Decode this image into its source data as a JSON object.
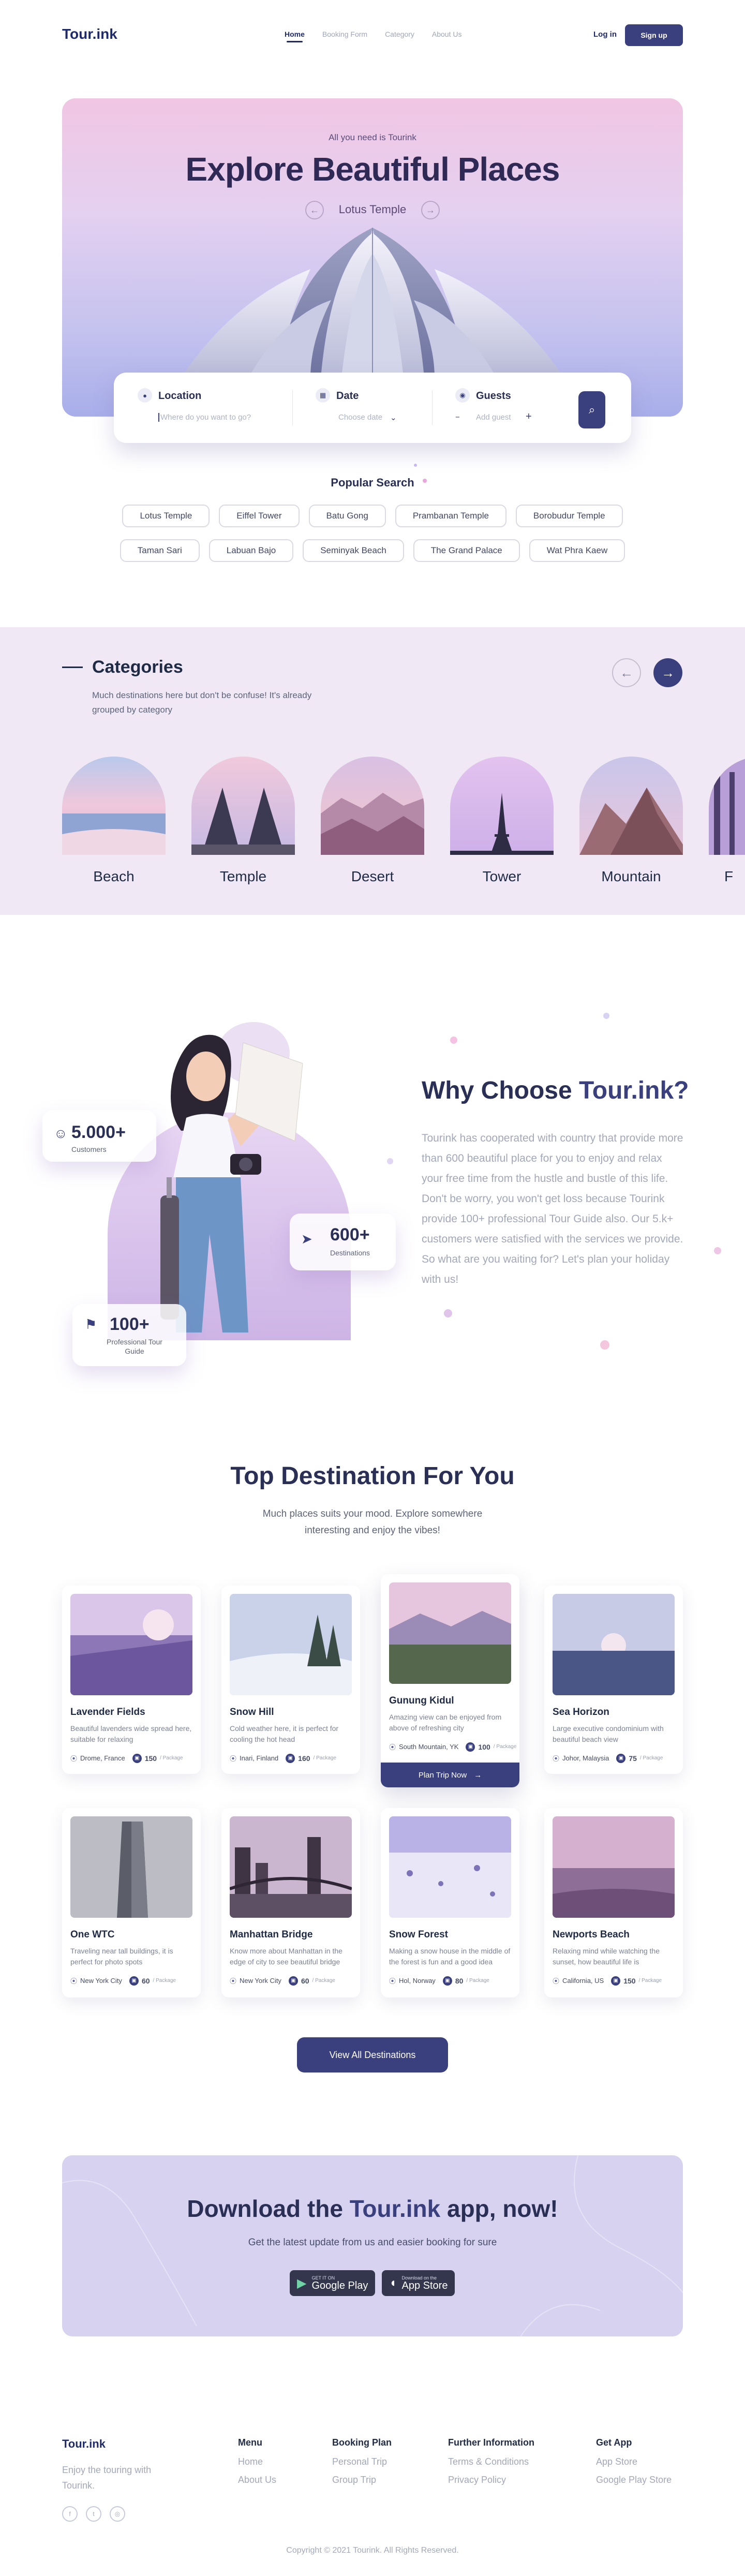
{
  "nav": {
    "logo": "Tour.ink",
    "links": [
      "Home",
      "Booking Form",
      "Category",
      "About Us"
    ],
    "login": "Log in",
    "signup": "Sign up"
  },
  "hero": {
    "tagline": "All you need is Tourink",
    "title": "Explore Beautiful Places",
    "place": "Lotus Temple",
    "prev_icon": "arrow-left-icon",
    "next_icon": "arrow-right-icon"
  },
  "search": {
    "location_label": "Location",
    "location_placeholder": "Where do you want to go?",
    "date_label": "Date",
    "date_value": "Choose date",
    "guests_label": "Guests",
    "guests_value": "Add guest",
    "decrease": "−",
    "increase": "+"
  },
  "popular": {
    "title": "Popular Search",
    "row1": [
      "Lotus Temple",
      "Eiffel Tower",
      "Batu Gong",
      "Prambanan Temple",
      "Borobudur Temple"
    ],
    "row2": [
      "Taman Sari",
      "Labuan Bajo",
      "Seminyak Beach",
      "The Grand Palace",
      "Wat Phra Kaew"
    ]
  },
  "categories": {
    "title": "Categories",
    "description": "Much destinations here but don't be confuse! It's already grouped by category",
    "items": [
      "Beach",
      "Temple",
      "Desert",
      "Tower",
      "Mountain",
      "F"
    ]
  },
  "why": {
    "title_a": "Why Choose ",
    "title_b": "Tour.ink?",
    "body": "Tourink has cooperated with country that provide more than 600 beautiful place for you to enjoy and relax your free time from the hustle and bustle of this life. Don't be worry, you won't get loss because Tourink provide 100+ professional Tour Guide also. Our 5.k+ customers were satisfied with the services we provide. So what are you waiting for? Let's plan your holiday with us!",
    "stats": [
      {
        "num": "5.000+",
        "cap": "Customers"
      },
      {
        "num": "600+",
        "cap": "Destinations"
      },
      {
        "num": "100+",
        "cap": "Professional Tour Guide"
      }
    ]
  },
  "top": {
    "title": "Top Destination For You",
    "subtitle": "Much places suits your mood. Explore somewhere interesting and enjoy the vibes!",
    "package_suffix": "/ Package",
    "plan_label": "Plan Trip Now",
    "cards": [
      {
        "name": "Lavender Fields",
        "desc": "Beautiful lavenders wide spread here, suitable for relaxing",
        "loc": "Drome, France",
        "count": "150"
      },
      {
        "name": "Snow Hill",
        "desc": "Cold weather here, it is perfect for cooling the hot head",
        "loc": "Inari, Finland",
        "count": "160"
      },
      {
        "name": "Gunung Kidul",
        "desc": "Amazing view can be enjoyed from above of refreshing city",
        "loc": "South Mountain, YK",
        "count": "100"
      },
      {
        "name": "Sea Horizon",
        "desc": "Large executive condominium with beautiful beach view",
        "loc": "Johor, Malaysia",
        "count": "75"
      },
      {
        "name": "One WTC",
        "desc": "Traveling near tall buildings, it is perfect for photo spots",
        "loc": "New York City",
        "count": "60"
      },
      {
        "name": "Manhattan Bridge",
        "desc": "Know more about Manhattan in the edge of city to see beautiful bridge",
        "loc": "New York City",
        "count": "60"
      },
      {
        "name": "Snow Forest",
        "desc": "Making a snow house in the middle of the forest is fun and a good idea",
        "loc": "Hol, Norway",
        "count": "80"
      },
      {
        "name": "Newports Beach",
        "desc": "Relaxing mind while watching the sunset, how beautiful life is",
        "loc": "California, US",
        "count": "150"
      }
    ],
    "view_all": "View All Destinations"
  },
  "app": {
    "title_a": "Download the ",
    "title_b": "Tour.ink",
    "title_c": " app, now!",
    "subtitle": "Get the latest update from us and easier booking for sure",
    "google_small": "GET IT ON",
    "google": "Google Play",
    "apple_small": "Download on the",
    "apple": "App Store"
  },
  "footer": {
    "logo": "Tour.ink",
    "tagline": "Enjoy the touring with Tourink.",
    "cols": [
      {
        "h": "Menu",
        "items": [
          "Home",
          "About Us"
        ]
      },
      {
        "h": "Booking Plan",
        "items": [
          "Personal Trip",
          "Group Trip"
        ]
      },
      {
        "h": "Further Information",
        "items": [
          "Terms & Conditions",
          "Privacy Policy"
        ]
      },
      {
        "h": "Get App",
        "items": [
          "App Store",
          "Google Play Store"
        ]
      }
    ],
    "copyright": "Copyright © 2021 Tourink. All Rights Reserved."
  },
  "colors": {
    "primary": "#3a3f7d",
    "category_bg": "#f0e8f5",
    "app_bg": "#d7d2f0"
  }
}
